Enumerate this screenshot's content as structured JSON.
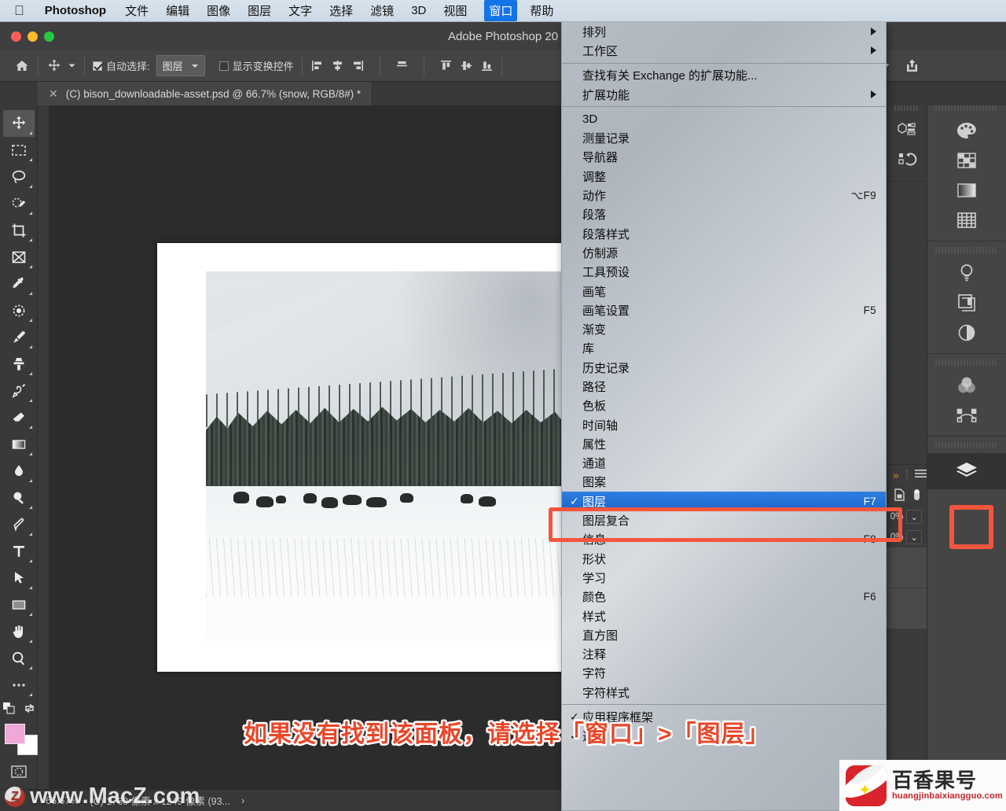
{
  "menubar": {
    "apple_icon": "apple-logo-icon",
    "app_name": "Photoshop",
    "items": [
      {
        "label": "文件",
        "active": false
      },
      {
        "label": "编辑",
        "active": false
      },
      {
        "label": "图像",
        "active": false
      },
      {
        "label": "图层",
        "active": false
      },
      {
        "label": "文字",
        "active": false
      },
      {
        "label": "选择",
        "active": false
      },
      {
        "label": "滤镜",
        "active": false
      },
      {
        "label": "3D",
        "active": false
      },
      {
        "label": "视图",
        "active": false
      },
      {
        "label": "窗口",
        "active": true
      },
      {
        "label": "帮助",
        "active": false
      }
    ]
  },
  "window": {
    "title": "Adobe Photoshop 20",
    "traffic_lights": [
      "close-button",
      "minimize-button",
      "zoom-button"
    ]
  },
  "options_bar": {
    "home_icon": "home-icon",
    "tool_icon": "move-tool-icon",
    "auto_select_label": "自动选择:",
    "auto_select_checked": true,
    "auto_select_value": "图层",
    "show_transform_label": "显示变换控件",
    "show_transform_checked": false,
    "align_icons": [
      "align-left-edges-icon",
      "align-horizontal-centers-icon",
      "align-right-edges-icon",
      "align-middle-icon",
      "align-top-edges-icon",
      "align-vertical-centers-icon",
      "align-bottom-edges-icon"
    ],
    "right_icons": [
      "search-icon",
      "workspace-switcher-icon",
      "chevron-down-icon",
      "share-icon"
    ]
  },
  "document_tab": {
    "close_icon": "close-icon",
    "title": "(C) bison_downloadable-asset.psd @ 66.7% (snow, RGB/8#) *"
  },
  "toolbar": {
    "tools": [
      {
        "name": "move-tool",
        "selected": true
      },
      {
        "name": "rectangular-marquee-tool",
        "selected": false
      },
      {
        "name": "lasso-tool",
        "selected": false
      },
      {
        "name": "quick-selection-tool",
        "selected": false
      },
      {
        "name": "crop-tool",
        "selected": false
      },
      {
        "name": "frame-tool",
        "selected": false
      },
      {
        "name": "eyedropper-tool",
        "selected": false
      },
      {
        "name": "spot-healing-brush-tool",
        "selected": false
      },
      {
        "name": "brush-tool",
        "selected": false
      },
      {
        "name": "clone-stamp-tool",
        "selected": false
      },
      {
        "name": "history-brush-tool",
        "selected": false
      },
      {
        "name": "eraser-tool",
        "selected": false
      },
      {
        "name": "gradient-tool",
        "selected": false
      },
      {
        "name": "blur-tool",
        "selected": false
      },
      {
        "name": "dodge-tool",
        "selected": false
      },
      {
        "name": "pen-tool",
        "selected": false
      },
      {
        "name": "type-tool",
        "selected": false
      },
      {
        "name": "path-selection-tool",
        "selected": false
      },
      {
        "name": "rectangle-tool",
        "selected": false
      },
      {
        "name": "hand-tool",
        "selected": false
      },
      {
        "name": "zoom-tool",
        "selected": false
      },
      {
        "name": "edit-toolbar-tool",
        "selected": false
      }
    ],
    "foreground_color": "#f0a8d8",
    "background_color": "#ffffff",
    "quick_mask_icon": "quick-mask-icon"
  },
  "window_menu": {
    "groups": [
      {
        "items": [
          {
            "label": "排列",
            "shortcut": "",
            "checked": false,
            "submenu": true
          },
          {
            "label": "工作区",
            "shortcut": "",
            "checked": false,
            "submenu": true
          }
        ]
      },
      {
        "items": [
          {
            "label": "查找有关 Exchange 的扩展功能...",
            "shortcut": "",
            "checked": false,
            "submenu": false
          },
          {
            "label": "扩展功能",
            "shortcut": "",
            "checked": false,
            "submenu": true
          }
        ]
      },
      {
        "items": [
          {
            "label": "3D",
            "shortcut": "",
            "checked": false,
            "submenu": false
          },
          {
            "label": "测量记录",
            "shortcut": "",
            "checked": false,
            "submenu": false
          },
          {
            "label": "导航器",
            "shortcut": "",
            "checked": false,
            "submenu": false
          },
          {
            "label": "调整",
            "shortcut": "",
            "checked": false,
            "submenu": false
          },
          {
            "label": "动作",
            "shortcut": "⌥F9",
            "checked": false,
            "submenu": false
          },
          {
            "label": "段落",
            "shortcut": "",
            "checked": false,
            "submenu": false
          },
          {
            "label": "段落样式",
            "shortcut": "",
            "checked": false,
            "submenu": false
          },
          {
            "label": "仿制源",
            "shortcut": "",
            "checked": false,
            "submenu": false
          },
          {
            "label": "工具预设",
            "shortcut": "",
            "checked": false,
            "submenu": false
          },
          {
            "label": "画笔",
            "shortcut": "",
            "checked": false,
            "submenu": false
          },
          {
            "label": "画笔设置",
            "shortcut": "F5",
            "checked": false,
            "submenu": false
          },
          {
            "label": "渐变",
            "shortcut": "",
            "checked": false,
            "submenu": false
          },
          {
            "label": "库",
            "shortcut": "",
            "checked": false,
            "submenu": false
          },
          {
            "label": "历史记录",
            "shortcut": "",
            "checked": false,
            "submenu": false
          },
          {
            "label": "路径",
            "shortcut": "",
            "checked": false,
            "submenu": false
          },
          {
            "label": "色板",
            "shortcut": "",
            "checked": false,
            "submenu": false
          },
          {
            "label": "时间轴",
            "shortcut": "",
            "checked": false,
            "submenu": false
          },
          {
            "label": "属性",
            "shortcut": "",
            "checked": false,
            "submenu": false
          },
          {
            "label": "通道",
            "shortcut": "",
            "checked": false,
            "submenu": false
          },
          {
            "label": "图案",
            "shortcut": "",
            "checked": false,
            "submenu": false
          },
          {
            "label": "图层",
            "shortcut": "F7",
            "checked": true,
            "submenu": false,
            "highlighted": true
          },
          {
            "label": "图层复合",
            "shortcut": "",
            "checked": false,
            "submenu": false
          },
          {
            "label": "信息",
            "shortcut": "F8",
            "checked": false,
            "submenu": false
          },
          {
            "label": "形状",
            "shortcut": "",
            "checked": false,
            "submenu": false
          },
          {
            "label": "学习",
            "shortcut": "",
            "checked": false,
            "submenu": false
          },
          {
            "label": "颜色",
            "shortcut": "F6",
            "checked": false,
            "submenu": false
          },
          {
            "label": "样式",
            "shortcut": "",
            "checked": false,
            "submenu": false
          },
          {
            "label": "直方图",
            "shortcut": "",
            "checked": false,
            "submenu": false
          },
          {
            "label": "注释",
            "shortcut": "",
            "checked": false,
            "submenu": false
          },
          {
            "label": "字符",
            "shortcut": "",
            "checked": false,
            "submenu": false
          },
          {
            "label": "字符样式",
            "shortcut": "",
            "checked": false,
            "submenu": false
          }
        ]
      },
      {
        "items": [
          {
            "label": "应用程序框架",
            "shortcut": "",
            "checked": true,
            "submenu": false
          },
          {
            "label": "选项",
            "shortcut": "",
            "checked": true,
            "submenu": false
          }
        ]
      }
    ]
  },
  "right_dock": {
    "collapse_icon_left": "collapse-panel-icon",
    "collapse_icon_right": "collapse-panel-icon",
    "narrow_rail_groups": [
      {
        "items": [
          "3d-panel-icon",
          "history-panel-icon"
        ]
      }
    ],
    "wide_rail_groups": [
      {
        "items": [
          "color-panel-icon",
          "swatches-panel-icon",
          "gradients-panel-icon",
          "patterns-panel-icon"
        ]
      },
      {
        "items": [
          "adjustments-panel-icon",
          "layer-comps-panel-icon",
          "styles-panel-icon"
        ]
      },
      {
        "items": [
          "channels-panel-icon",
          "paths-panel-icon"
        ]
      },
      {
        "items": [
          "layers-panel-icon"
        ]
      }
    ],
    "layers_panel": {
      "expand_icon": "expand-panels-icon",
      "menu_icon": "panel-menu-icon",
      "lock_icon": "lock-icon",
      "visibility_icon": "eye-icon",
      "opacity_value": "0%",
      "fill_value": "0%",
      "delete_icon": "trash-icon"
    }
  },
  "canvas": {
    "artboard_label": "snow-photograph-artboard",
    "photo_description": "snowy-mountain-bison-herd-photo"
  },
  "annotation": {
    "caption": "如果没有找到该面板，请选择「窗口」>「图层」",
    "highlight_color": "#f4553d"
  },
  "status_bar": {
    "zoom": "66.67%",
    "dimensions": "(C) 1760 像素 x 1249 像素 (93...",
    "chevron": "›"
  },
  "watermarks": {
    "macz": "www.MacZ.com",
    "bxg_cn": "百香果号",
    "bxg_url": "huangjinbaixiangguo.com"
  }
}
